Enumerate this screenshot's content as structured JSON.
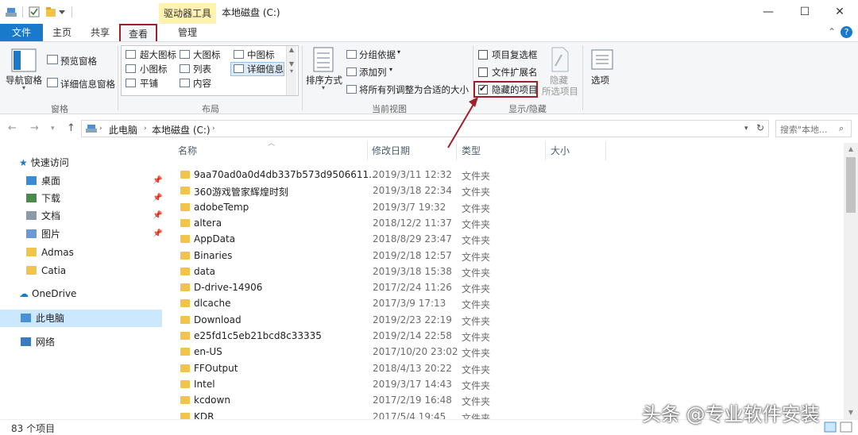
{
  "titlebar": {
    "context_tab": "驱动器工具",
    "title": "本地磁盘 (C:)",
    "controls": [
      "—",
      "☐",
      "✕"
    ]
  },
  "tabs": {
    "file": "文件",
    "home": "主页",
    "share": "共享",
    "view": "查看",
    "manage": "管理"
  },
  "ribbon": {
    "panes": {
      "nav_pane": "导航窗格",
      "preview_pane": "预览窗格",
      "details_pane": "详细信息窗格",
      "group_label": "窗格"
    },
    "layout": {
      "extra_large": "超大图标",
      "large": "大图标",
      "medium": "中图标",
      "small": "小图标",
      "list": "列表",
      "details": "详细信息",
      "tiles": "平铺",
      "content": "内容",
      "group_label": "布局"
    },
    "current_view": {
      "sort_by": "排序方式",
      "group_by": "分组依据",
      "add_columns": "添加列",
      "fit_columns": "将所有列调整为合适的大小",
      "group_label": "当前视图"
    },
    "show_hide": {
      "item_checkboxes": "项目复选框",
      "file_extensions": "文件扩展名",
      "hidden_items": "隐藏的项目",
      "hidden_items_checked": true,
      "item_checkboxes_checked": false,
      "file_extensions_checked": false,
      "hide_label": "隐藏",
      "hide_sub": "所选项目",
      "group_label": "显示/隐藏"
    },
    "options": "选项"
  },
  "address": {
    "crumbs": [
      "此电脑",
      "本地磁盘 (C:)"
    ],
    "search_placeholder": "搜索\"本地..."
  },
  "nav": {
    "quick_access": "快速访问",
    "items": [
      {
        "label": "桌面",
        "pinned": true
      },
      {
        "label": "下载",
        "pinned": true
      },
      {
        "label": "文档",
        "pinned": true
      },
      {
        "label": "图片",
        "pinned": true
      },
      {
        "label": "Admas",
        "pinned": false
      },
      {
        "label": "Catia",
        "pinned": false
      }
    ],
    "onedrive": "OneDrive",
    "this_pc": "此电脑",
    "network": "网络"
  },
  "columns": {
    "name": "名称",
    "date": "修改日期",
    "type": "类型",
    "size": "大小"
  },
  "files": [
    {
      "name": "9aa70ad0a0d4db337b573d9506611...",
      "date": "2019/3/11 12:32",
      "type": "文件夹"
    },
    {
      "name": "360游戏管家辉煌时刻",
      "date": "2019/3/18 22:34",
      "type": "文件夹"
    },
    {
      "name": "adobeTemp",
      "date": "2019/3/7 19:32",
      "type": "文件夹"
    },
    {
      "name": "altera",
      "date": "2018/12/2 11:37",
      "type": "文件夹"
    },
    {
      "name": "AppData",
      "date": "2018/8/29 23:47",
      "type": "文件夹"
    },
    {
      "name": "Binaries",
      "date": "2019/2/18 12:57",
      "type": "文件夹"
    },
    {
      "name": "data",
      "date": "2019/3/18 15:38",
      "type": "文件夹"
    },
    {
      "name": "D-drive-14906",
      "date": "2017/2/24 11:26",
      "type": "文件夹"
    },
    {
      "name": "dlcache",
      "date": "2017/3/9 17:13",
      "type": "文件夹"
    },
    {
      "name": "Download",
      "date": "2019/2/23 22:19",
      "type": "文件夹"
    },
    {
      "name": "e25fd1c5eb21bcd8c33335",
      "date": "2019/2/14 22:58",
      "type": "文件夹"
    },
    {
      "name": "en-US",
      "date": "2017/10/20 23:02",
      "type": "文件夹"
    },
    {
      "name": "FFOutput",
      "date": "2018/4/13 20:22",
      "type": "文件夹"
    },
    {
      "name": "Intel",
      "date": "2019/3/17 14:43",
      "type": "文件夹"
    },
    {
      "name": "kcdown",
      "date": "2017/2/19 16:48",
      "type": "文件夹"
    },
    {
      "name": "KDR",
      "date": "2017/5/4 19:45",
      "type": "文件夹"
    }
  ],
  "status": {
    "count": "83 个项目"
  },
  "watermark": "头条 @专业软件安装",
  "colors": {
    "accent": "#1979ca",
    "highlight_border": "#a0202a",
    "context_tab_bg": "#fff2b3",
    "folder": "#f3c44b",
    "selected_nav": "#cce8ff"
  }
}
